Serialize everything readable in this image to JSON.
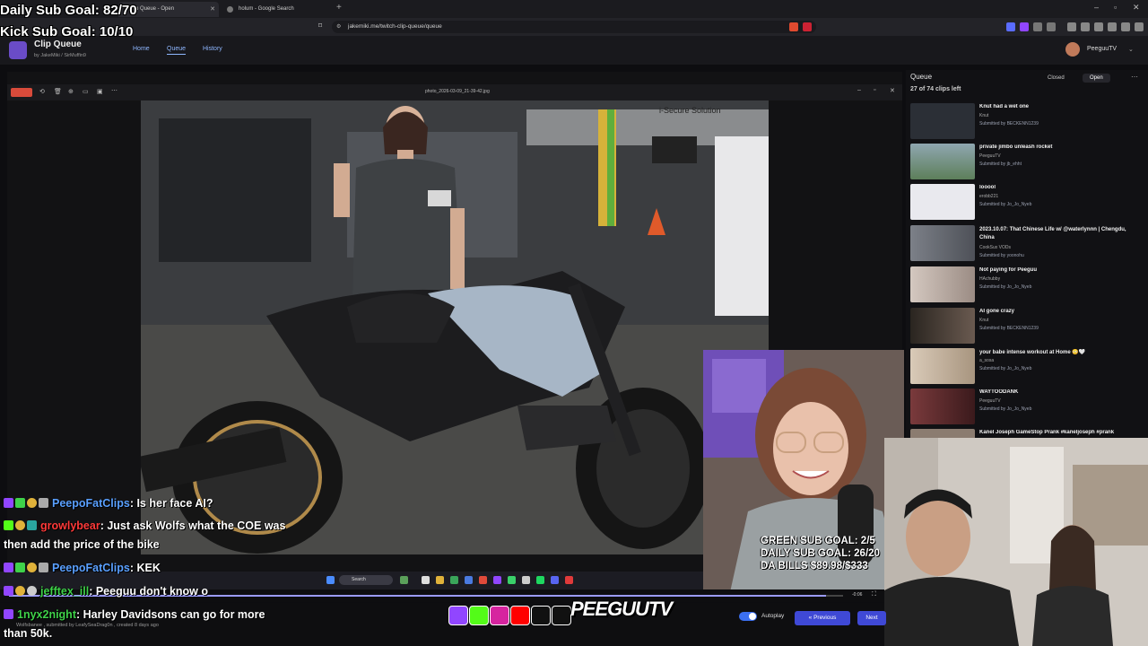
{
  "browser": {
    "tabs": [
      {
        "label": "Clip Queue - Open"
      },
      {
        "label": "holum - Google Search"
      }
    ],
    "url": "jakemiki.me/twitch-clip-queue/queue"
  },
  "overlay": {
    "daily_sub_goal": "Daily Sub Goal: 82/70",
    "kick_sub_goal": "Kick Sub Goal: 10/10"
  },
  "app": {
    "name": "Clip Queue",
    "byline": "by JakeMiki / SirMuffin9",
    "nav": [
      "Home",
      "Queue",
      "History"
    ],
    "user": "PeeguuTV"
  },
  "viewer": {
    "filename": "photo_2026-03-09_21-39-42.jpg",
    "sign_text": "i-Secure Solution"
  },
  "queue": {
    "title": "Queue",
    "count": "27 of 74 clips left",
    "closed_label": "Closed",
    "open_label": "Open",
    "items": [
      {
        "title": "Knut had a wet one",
        "channel": "Knut",
        "submitted": "Submitted by BECKENN1239",
        "color": "#2b2f36"
      },
      {
        "title": "private jimbo unleash rocket",
        "channel": "PeeguuTV",
        "submitted": "Submitted by jb_ehht",
        "color": "#5d7f5a"
      },
      {
        "title": "looool",
        "channel": "erobb221",
        "submitted": "Submitted by Jo_Jo_Nyeb",
        "color": "#e9e9ee"
      },
      {
        "title": "2023.10.07: That Chinese Life w/ @waterlynnn | Chengdu, China",
        "channel": "CookSux VODs",
        "submitted": "Submitted by yoonohu",
        "color": "#6b6f78"
      },
      {
        "title": "Not paying for Peeguu",
        "channel": "HAchubby",
        "submitted": "Submitted by Jo_Jo_Nyeb",
        "color": "#b7a9a0"
      },
      {
        "title": "AI gone crazy",
        "channel": "Knut",
        "submitted": "Submitted by BECKENN1239",
        "color": "#3a3530"
      },
      {
        "title": "your babe intense workout at Home 😳🤍",
        "channel": "a_sosa",
        "submitted": "Submitted by Jo_Jo_Nyeb",
        "color": "#c9b8a5"
      },
      {
        "title": "WAYTOODANK",
        "channel": "PeeguuTV",
        "submitted": "Submitted by Jo_Jo_Nyeb",
        "color": "#5a2a2c"
      },
      {
        "title": "Kanel Joseph GameStop Prank #kaneljoseph #prank",
        "channel": "",
        "submitted": "",
        "color": "#8b7c70"
      }
    ]
  },
  "stream": {
    "green_goal": "GREEN SUB GOAL: 2/5",
    "daily_goal": "DAILY SUB GOAL: 26/20",
    "bills": "DA BILLS $89.98/$333"
  },
  "chat": [
    {
      "user": "PeepoFatClips",
      "user_color": "#5aa0ff",
      "text": ": Is her face AI?"
    },
    {
      "user": "growlybear",
      "user_color": "#ff3a3a",
      "text": ": Just ask Wolfs what the COE was"
    },
    {
      "user": "",
      "user_color": "#ffffff",
      "text": "then add the price of the bike"
    },
    {
      "user": "PeepoFatClips",
      "user_color": "#5aa0ff",
      "text": ": KEK"
    },
    {
      "user": "jefftex_ill",
      "user_color": "#3fd24a",
      "text": ": Peeguu don't know o"
    },
    {
      "user": "1nyx2night",
      "user_color": "#3fd24a",
      "text": ": Harley Davidsons can go for more"
    },
    {
      "user": "",
      "user_color": "#ffffff",
      "text": "than 50k."
    }
  ],
  "player": {
    "submitted_line": "Wolfsbanee , submitted by LeafySeaDrag0n , created 8 days ago",
    "time": "-0:06",
    "progress": 0.98,
    "autoplay_label": "Autoplay",
    "previous_label": "Previous",
    "next_label": "Next"
  },
  "taskbar": {
    "search": "Search"
  },
  "brand": {
    "name": "PEEGUUTV"
  }
}
